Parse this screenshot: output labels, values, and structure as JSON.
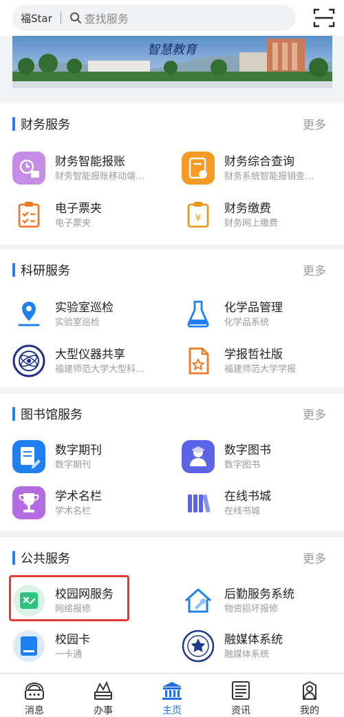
{
  "header": {
    "brand": "福Star",
    "search_placeholder": "查找服务",
    "scan_icon": "scan-icon"
  },
  "banner": {
    "caption": "智慧教育"
  },
  "sections": [
    {
      "title": "财务服务",
      "more": "更多",
      "items": [
        {
          "name": "财务智能报账",
          "sub": "财务智能报账移动端…",
          "icon": "finance-report-icon"
        },
        {
          "name": "财务综合查询",
          "sub": "财务系统智能报销查…",
          "icon": "finance-query-icon"
        },
        {
          "name": "电子票夹",
          "sub": "电子票夹",
          "icon": "ticket-folder-icon"
        },
        {
          "name": "财务缴费",
          "sub": "财务网上缴费",
          "icon": "payment-icon"
        }
      ]
    },
    {
      "title": "科研服务",
      "more": "更多",
      "items": [
        {
          "name": "实验室巡检",
          "sub": "实验室巡检",
          "icon": "location-pin-icon"
        },
        {
          "name": "化学品管理",
          "sub": "化学品系统",
          "icon": "flask-icon"
        },
        {
          "name": "大型仪器共享",
          "sub": "福建师范大学大型科…",
          "icon": "university-seal-icon"
        },
        {
          "name": "学报哲社版",
          "sub": "福建师范大学学报",
          "icon": "journal-icon"
        }
      ]
    },
    {
      "title": "图书馆服务",
      "more": "更多",
      "items": [
        {
          "name": "数字期刊",
          "sub": "数字期刊",
          "icon": "digital-journal-icon"
        },
        {
          "name": "数字图书",
          "sub": "数字图书",
          "icon": "digital-book-icon"
        },
        {
          "name": "学术名栏",
          "sub": "学术名栏",
          "icon": "trophy-icon"
        },
        {
          "name": "在线书城",
          "sub": "在线书城",
          "icon": "bookshelf-icon"
        }
      ]
    },
    {
      "title": "公共服务",
      "more": "更多",
      "items": [
        {
          "name": "校园网服务",
          "sub": "网络报修",
          "icon": "campus-network-icon"
        },
        {
          "name": "后勤服务系统",
          "sub": "物资损坏报修",
          "icon": "house-repair-icon"
        },
        {
          "name": "校园卡",
          "sub": "一卡通",
          "icon": "campus-card-icon"
        },
        {
          "name": "融媒体系统",
          "sub": "融媒体系统",
          "icon": "media-center-icon"
        }
      ]
    }
  ],
  "tabs": [
    {
      "label": "消息",
      "icon": "message-icon",
      "active": false
    },
    {
      "label": "办事",
      "icon": "affairs-icon",
      "active": false
    },
    {
      "label": "主页",
      "icon": "home-building-icon",
      "active": true
    },
    {
      "label": "资讯",
      "icon": "news-icon",
      "active": false
    },
    {
      "label": "我的",
      "icon": "profile-icon",
      "active": false
    }
  ],
  "colors": {
    "accent": "#1f7ef0",
    "highlight_box": "#e53935",
    "active_tab": "#1f6fe0"
  }
}
